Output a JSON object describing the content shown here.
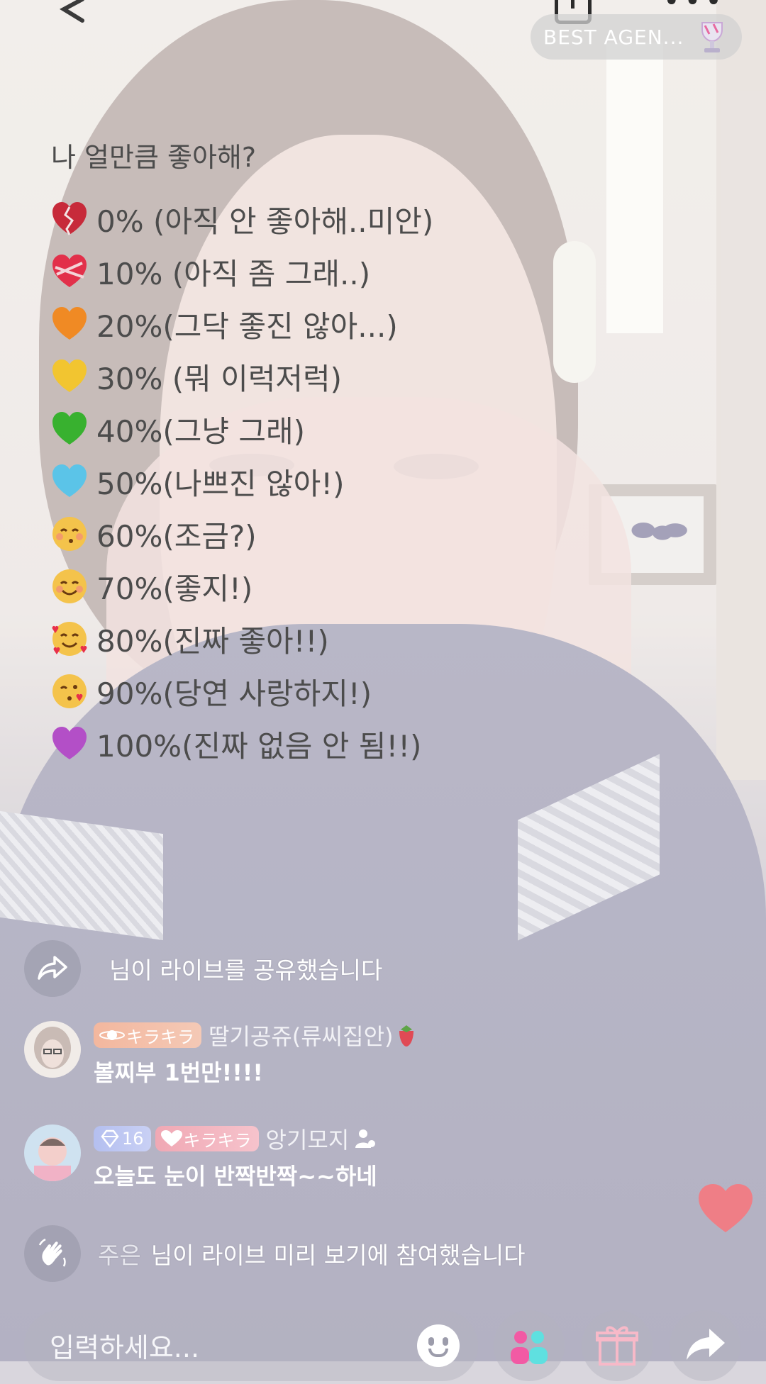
{
  "header": {
    "back_icon": "chevron-left-icon",
    "badge_text": "BEST AGEN...",
    "badge_icon": "trophy-icon"
  },
  "poll": {
    "title": "나 얼만큼 좋아해?",
    "items": [
      {
        "emoji": "broken-heart",
        "text": "0% (아직 안 좋아해..미안)"
      },
      {
        "emoji": "heart-with-ribbon",
        "text": "10% (아직 좀 그래..)"
      },
      {
        "emoji": "orange-heart",
        "text": "20%(그닥 좋진 않아...)"
      },
      {
        "emoji": "yellow-heart",
        "text": "30% (뭐 이럭저럭)"
      },
      {
        "emoji": "green-heart",
        "text": "40%(그냥 그래)"
      },
      {
        "emoji": "blue-heart",
        "text": "50%(나쁘진 않아!)"
      },
      {
        "emoji": "kissing-face",
        "text": "60%(조금?)"
      },
      {
        "emoji": "smiling-face",
        "text": "70%(좋지!)"
      },
      {
        "emoji": "smiling-face-with-hearts",
        "text": "80%(진짜 좋아!!)"
      },
      {
        "emoji": "face-blowing-kiss",
        "text": "90%(당연 사랑하지!)"
      },
      {
        "emoji": "purple-heart",
        "text": "100%(진짜 없음 안 됨!!)"
      }
    ]
  },
  "chat": {
    "share_notice": "님이 라이브를 공유했습니다",
    "comments": [
      {
        "badges": [
          "キラキラ"
        ],
        "name": "딸기공쥬(류씨집안)",
        "text": "볼찌부 1번만!!!!"
      },
      {
        "level": "16",
        "badges": [
          "キラキラ"
        ],
        "name": "앙기모지",
        "text": "오늘도 눈이 반짝반짝~~하네"
      }
    ],
    "join_notice_name": "주은",
    "join_notice": "님이 라이브 미리 보기에 참여했습니다"
  },
  "input": {
    "placeholder": "입력하세요..."
  },
  "colors": {
    "like_heart": "#ef7e86",
    "badge_kira": "#f3b79e",
    "badge_level": "#b4bff0"
  }
}
